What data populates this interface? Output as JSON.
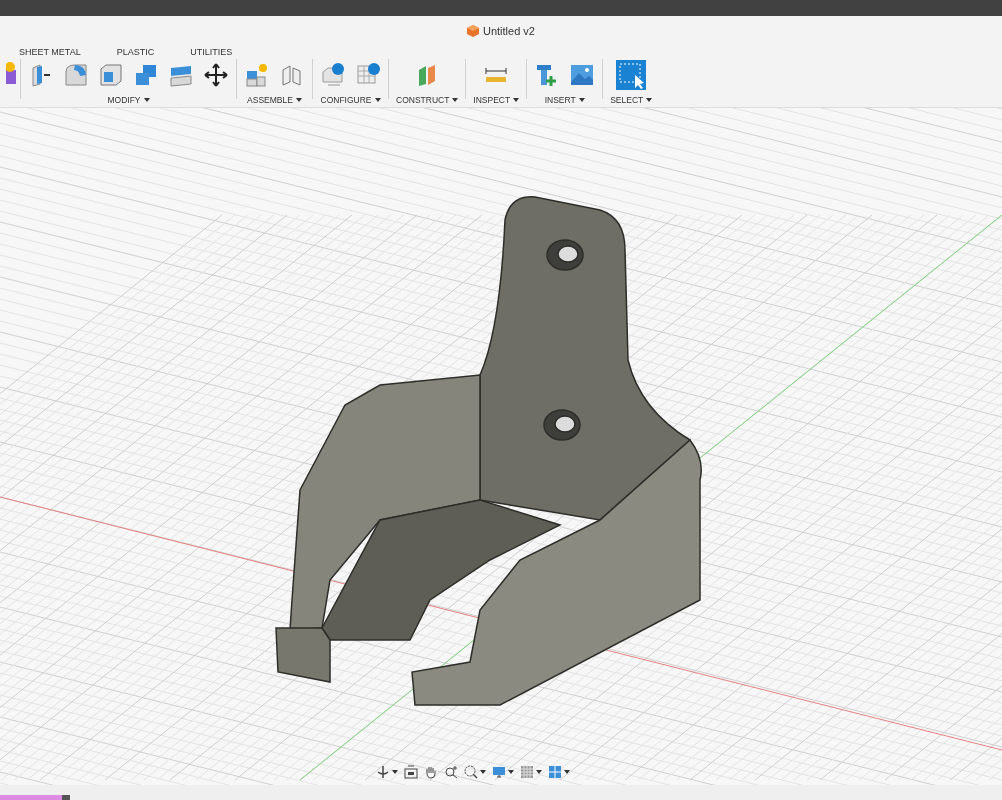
{
  "window": {
    "title": "Untitled v2"
  },
  "tabs": [
    {
      "label": "SHEET METAL"
    },
    {
      "label": "PLASTIC"
    },
    {
      "label": "UTILITIES"
    }
  ],
  "toolbar_groups": [
    {
      "label": "MODIFY"
    },
    {
      "label": "ASSEMBLE"
    },
    {
      "label": "CONFIGURE"
    },
    {
      "label": "CONSTRUCT"
    },
    {
      "label": "INSPECT"
    },
    {
      "label": "INSERT"
    },
    {
      "label": "SELECT"
    }
  ]
}
